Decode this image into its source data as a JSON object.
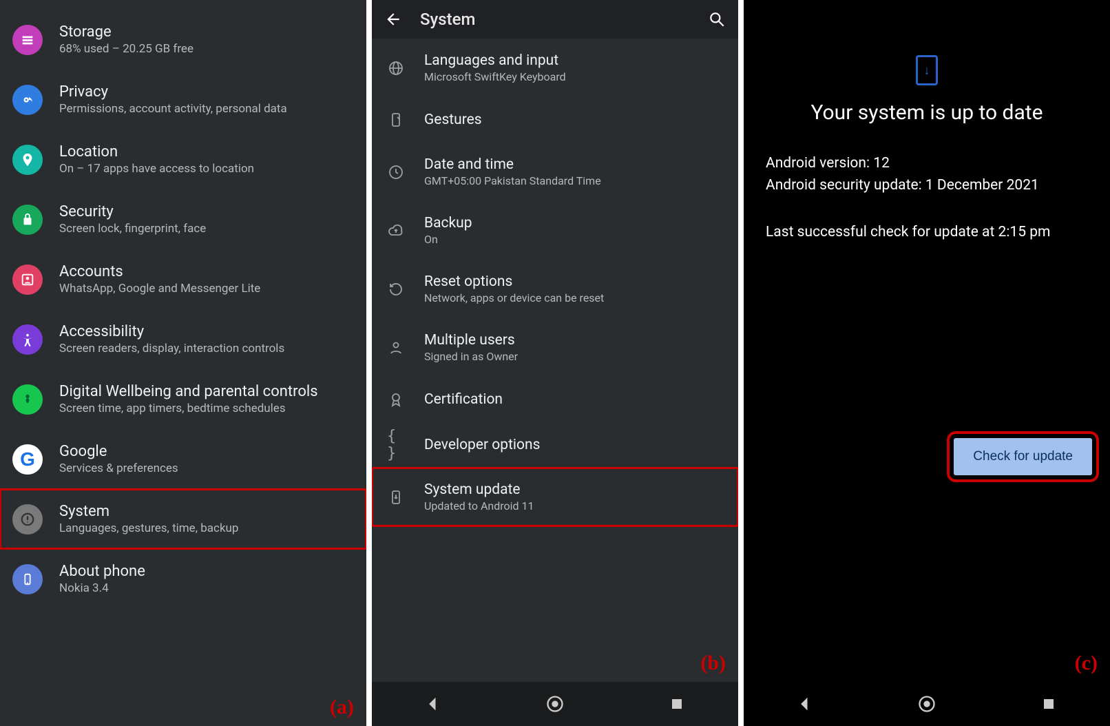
{
  "panelA": {
    "label": "(a)",
    "items": [
      {
        "icon": "storage-icon",
        "color": "#c23db9",
        "title": "Storage",
        "sub": "68% used – 20.25 GB free"
      },
      {
        "icon": "privacy-icon",
        "color": "#2f7de1",
        "title": "Privacy",
        "sub": "Permissions, account activity, personal data"
      },
      {
        "icon": "location-icon",
        "color": "#14b7a6",
        "title": "Location",
        "sub": "On – 17 apps have access to location"
      },
      {
        "icon": "security-icon",
        "color": "#17a85b",
        "title": "Security",
        "sub": "Screen lock, fingerprint, face"
      },
      {
        "icon": "accounts-icon",
        "color": "#e04063",
        "title": "Accounts",
        "sub": "WhatsApp, Google and Messenger Lite"
      },
      {
        "icon": "accessibility-icon",
        "color": "#7a3cd8",
        "title": "Accessibility",
        "sub": "Screen readers, display, interaction controls"
      },
      {
        "icon": "wellbeing-icon",
        "color": "#17c64f",
        "title": "Digital Wellbeing and parental controls",
        "sub": "Screen time, app timers, bedtime schedules"
      },
      {
        "icon": "google-icon",
        "color": "#1a73e8",
        "title": "Google",
        "sub": "Services & preferences"
      },
      {
        "icon": "system-icon",
        "color": "#7a7a7a",
        "title": "System",
        "sub": "Languages, gestures, time, backup",
        "highlight": true
      },
      {
        "icon": "about-icon",
        "color": "#5a7bd6",
        "title": "About phone",
        "sub": "Nokia 3.4"
      }
    ]
  },
  "panelB": {
    "title": "System",
    "label": "(b)",
    "items": [
      {
        "icon": "globe-icon",
        "title": "Languages and input",
        "sub": "Microsoft SwiftKey Keyboard"
      },
      {
        "icon": "gesture-icon",
        "title": "Gestures",
        "sub": ""
      },
      {
        "icon": "clock-icon",
        "title": "Date and time",
        "sub": "GMT+05:00 Pakistan Standard Time"
      },
      {
        "icon": "cloud-icon",
        "title": "Backup",
        "sub": "On"
      },
      {
        "icon": "reset-icon",
        "title": "Reset options",
        "sub": "Network, apps or device can be reset"
      },
      {
        "icon": "user-icon",
        "title": "Multiple users",
        "sub": "Signed in as Owner"
      },
      {
        "icon": "badge-icon",
        "title": "Certification",
        "sub": ""
      },
      {
        "icon": "braces-icon",
        "title": "Developer options",
        "sub": ""
      },
      {
        "icon": "update-icon",
        "title": "System update",
        "sub": "Updated to Android 11",
        "highlight": true
      }
    ]
  },
  "panelC": {
    "label": "(c)",
    "headline": "Your system is up to date",
    "version": "Android version: 12",
    "security": "Android security update: 1 December 2021",
    "lastCheck": "Last successful check for update at 2:15 pm",
    "button": "Check for update"
  }
}
